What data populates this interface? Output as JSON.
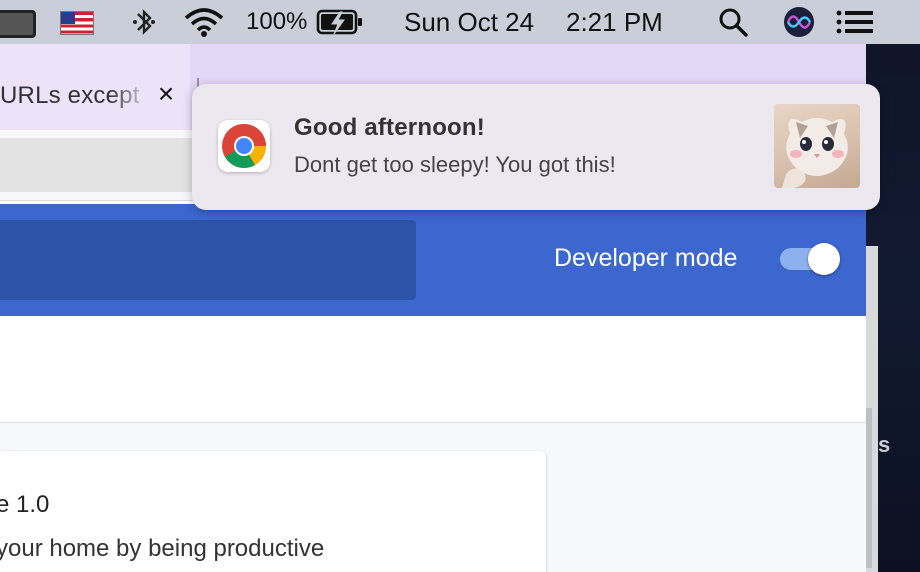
{
  "menubar": {
    "input_flag": "us-flag-icon",
    "battery_percent": "100%",
    "date": "Sun Oct 24",
    "time": "2:21 PM"
  },
  "browser": {
    "tab": {
      "title": "URLs except",
      "close": "×"
    },
    "extensions": {
      "developer_mode_label": "Developer mode",
      "developer_mode_on": true
    },
    "card": {
      "version": "e  1.0",
      "description": "your home by being productive"
    }
  },
  "notification": {
    "app_icon": "chrome-icon",
    "title": "Good afternoon!",
    "body": "Dont get too sleepy! You got this!",
    "image": "cat-photo"
  },
  "side_window": {
    "letter": "s"
  },
  "colors": {
    "header_blue": "#3b67cf",
    "tab_purple": "#e4d7f6",
    "menubar": "#c9ced8"
  }
}
